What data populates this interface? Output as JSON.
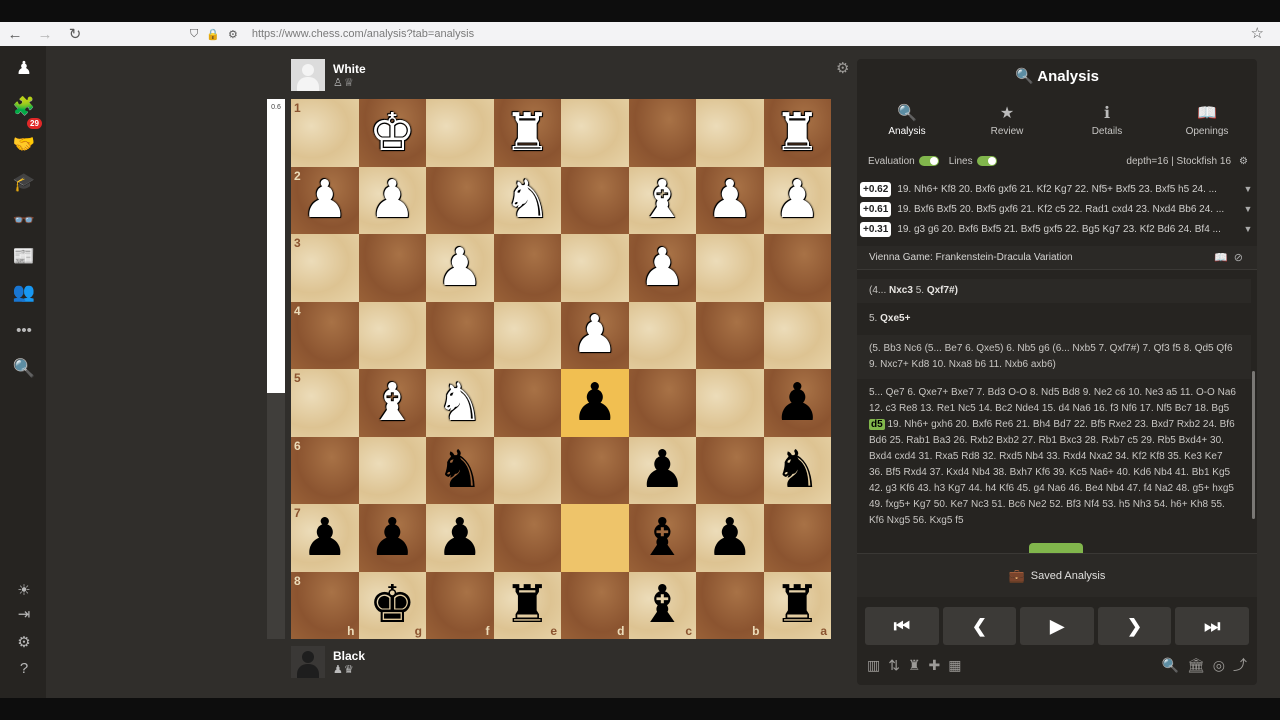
{
  "browser": {
    "url": "https://www.chess.com/analysis?tab=analysis",
    "back_icon": "←",
    "forward_icon": "→",
    "reload_icon": "↻",
    "shield_icon": "⛉",
    "lock_icon": "🔒",
    "settings_icon": "⚙",
    "star_icon": "☆"
  },
  "sidebar": {
    "badge": "29",
    "icons": [
      "♟",
      "🧩",
      "🤝",
      "🎓",
      "👓",
      "📰",
      "👥",
      "•••",
      "🔍"
    ],
    "bottom_icons": [
      "☀",
      "⇥",
      "⚙",
      "?"
    ]
  },
  "players": {
    "top": {
      "name": "White",
      "pieces": "♙♕"
    },
    "bottom": {
      "name": "Black",
      "pieces": "♟♛"
    }
  },
  "eval_bar": {
    "label": "0.6",
    "white_fraction": 0.545
  },
  "board": {
    "ranks": [
      "1",
      "2",
      "3",
      "4",
      "5",
      "6",
      "7",
      "8"
    ],
    "files": [
      "h",
      "g",
      "f",
      "e",
      "d",
      "c",
      "b",
      "a"
    ],
    "highlights": [
      {
        "row": 4,
        "col": 4
      },
      {
        "row": 6,
        "col": 4
      }
    ],
    "pieces": [
      {
        "row": 0,
        "col": 1,
        "glyph": "♚",
        "color": "w",
        "name": "white-king"
      },
      {
        "row": 0,
        "col": 3,
        "glyph": "♜",
        "color": "w",
        "name": "white-rook-e1"
      },
      {
        "row": 0,
        "col": 7,
        "glyph": "♜",
        "color": "w",
        "name": "white-rook-a1"
      },
      {
        "row": 1,
        "col": 0,
        "glyph": "♟",
        "color": "w",
        "name": "white-pawn-h2"
      },
      {
        "row": 1,
        "col": 1,
        "glyph": "♟",
        "color": "w",
        "name": "white-pawn-g2"
      },
      {
        "row": 1,
        "col": 3,
        "glyph": "♞",
        "color": "w",
        "name": "white-knight-e2"
      },
      {
        "row": 1,
        "col": 5,
        "glyph": "♝",
        "color": "w",
        "name": "white-bishop-c2"
      },
      {
        "row": 1,
        "col": 6,
        "glyph": "♟",
        "color": "w",
        "name": "white-pawn-b2"
      },
      {
        "row": 1,
        "col": 7,
        "glyph": "♟",
        "color": "w",
        "name": "white-pawn-a2"
      },
      {
        "row": 2,
        "col": 2,
        "glyph": "♟",
        "color": "w",
        "name": "white-pawn-f3"
      },
      {
        "row": 2,
        "col": 5,
        "glyph": "♟",
        "color": "w",
        "name": "white-pawn-c3"
      },
      {
        "row": 3,
        "col": 4,
        "glyph": "♟",
        "color": "w",
        "name": "white-pawn-d4"
      },
      {
        "row": 4,
        "col": 1,
        "glyph": "♝",
        "color": "w",
        "name": "white-bishop-g5"
      },
      {
        "row": 4,
        "col": 2,
        "glyph": "♞",
        "color": "w",
        "name": "white-knight-f5"
      },
      {
        "row": 4,
        "col": 4,
        "glyph": "♟",
        "color": "b",
        "name": "black-pawn-d5"
      },
      {
        "row": 4,
        "col": 7,
        "glyph": "♟",
        "color": "b",
        "name": "black-pawn-a5"
      },
      {
        "row": 5,
        "col": 2,
        "glyph": "♞",
        "color": "b",
        "name": "black-knight-f6"
      },
      {
        "row": 5,
        "col": 5,
        "glyph": "♟",
        "color": "b",
        "name": "black-pawn-c6"
      },
      {
        "row": 5,
        "col": 7,
        "glyph": "♞",
        "color": "b",
        "name": "black-knight-a6"
      },
      {
        "row": 6,
        "col": 0,
        "glyph": "♟",
        "color": "b",
        "name": "black-pawn-h7"
      },
      {
        "row": 6,
        "col": 1,
        "glyph": "♟",
        "color": "b",
        "name": "black-pawn-g7"
      },
      {
        "row": 6,
        "col": 2,
        "glyph": "♟",
        "color": "b",
        "name": "black-pawn-f7"
      },
      {
        "row": 6,
        "col": 5,
        "glyph": "♝",
        "color": "b",
        "name": "black-bishop-c7"
      },
      {
        "row": 6,
        "col": 6,
        "glyph": "♟",
        "color": "b",
        "name": "black-pawn-b7"
      },
      {
        "row": 7,
        "col": 1,
        "glyph": "♚",
        "color": "b",
        "name": "black-king"
      },
      {
        "row": 7,
        "col": 3,
        "glyph": "♜",
        "color": "b",
        "name": "black-rook-e8"
      },
      {
        "row": 7,
        "col": 5,
        "glyph": "♝",
        "color": "b",
        "name": "black-bishop-c8"
      },
      {
        "row": 7,
        "col": 7,
        "glyph": "♜",
        "color": "b",
        "name": "black-rook-a8"
      }
    ]
  },
  "board_gear_icon": "⚙",
  "panel": {
    "title": "Analysis",
    "title_icon": "🔍",
    "tabs": [
      {
        "label": "Analysis",
        "icon": "🔍"
      },
      {
        "label": "Review",
        "icon": "★"
      },
      {
        "label": "Details",
        "icon": "ℹ"
      },
      {
        "label": "Openings",
        "icon": "📖"
      }
    ],
    "evaluation_label": "Evaluation",
    "lines_label": "Lines",
    "depth_label": "depth=16 | Stockfish 16",
    "gear_icon": "⚙",
    "lines": [
      {
        "score": "+0.62",
        "text": "19. Nh6+ Kf8 20. Bxf6 gxf6 21. Kf2 Kg7 22. Nf5+ Bxf5 23. Bxf5 h5 24. ..."
      },
      {
        "score": "+0.61",
        "text": "19. Bxf6 Bxf5 20. Bxf5 gxf6 21. Kf2 c5 22. Rad1 cxd4 23. Nxd4 Bb6 24. ..."
      },
      {
        "score": "+0.31",
        "text": "19. g3 g6 20. Bxf6 Bxf5 21. Bxf5 gxf5 22. Bg5 Kg7 23. Kf2 Bd6 24. Bf4 ..."
      }
    ],
    "caret_icon": "▼",
    "opening": "Vienna Game: Frankenstein-Dracula Variation",
    "opening_icons": "📖⊘",
    "moves": {
      "m1": "(4...",
      "m1b": "Nxc3",
      "m1c": "5.",
      "m1d": "Qxf7#)",
      "m2": "5.",
      "m2b": "Qxe5+",
      "m3": "(5. Bb3 Nc6 (5... Be7 6. Qxe5) 6. Nb5 g6 (6... Nxb5 7. Qxf7#) 7. Qf3 f5 8. Qd5 Qf6 9. Nxc7+ Kd8 10. Nxa8 b6 11. Nxb6 axb6)",
      "m4a": "5... Qe7 6. Qxe7+ Bxe7 7. Bd3 O-O 8. Nd5 Bd8 9. Ne2 c6 10. Ne3 a5 11. O-O Na6 12. c3 Re8 13. Re1 Nc5 14. Bc2 Nde4 15. d4 Na6 16. f3 Nf6 17. Nf5 Bc7 18. Bg5",
      "m4hl": "d5",
      "m4b": "19. Nh6+ gxh6 20. Bxf6 Re6 21. Bh4 Bd7 22. Bf5 Rxe2 23. Bxd7 Rxb2 24. Bf6 Bd6 25. Rab1 Ba3 26. Rxb2 Bxb2 27. Rb1 Bxc3 28. Rxb7 c5 29. Rb5 Bxd4+ 30. Bxd4 cxd4 31. Rxa5 Rd8 32. Rxd5 Nb4 33. Rxd4 Nxa2 34. Kf2 Kf8 35. Ke3 Ke7 36. Bf5 Rxd4 37. Kxd4 Nb4 38. Bxh7 Kf6 39. Kc5 Na6+ 40. Kd6 Nb4 41. Bb1 Kg5 42. g3 Kf6 43. h3 Kg7 44. h4 Kf6 45. g4 Na6 46. Be4 Nb4 47. f4 Na2 48. g5+ hxg5 49. fxg5+ Kg7 50. Ke7 Nc3 51. Bc6 Ne2 52. Bf3 Nf4 53. h5 Nh3 54. h6+ Kh8 55. Kf6 Nxg5 56. Kxg5 f5"
    },
    "saved_label": "Saved Analysis",
    "saved_icon": "💼",
    "nav": [
      "⏮",
      "❮",
      "▶",
      "❯",
      "⏭"
    ],
    "tools": [
      "▥",
      "⇅",
      "♜",
      "✚",
      "▦",
      "🔍",
      "🏛",
      "◎",
      "⤴"
    ]
  }
}
